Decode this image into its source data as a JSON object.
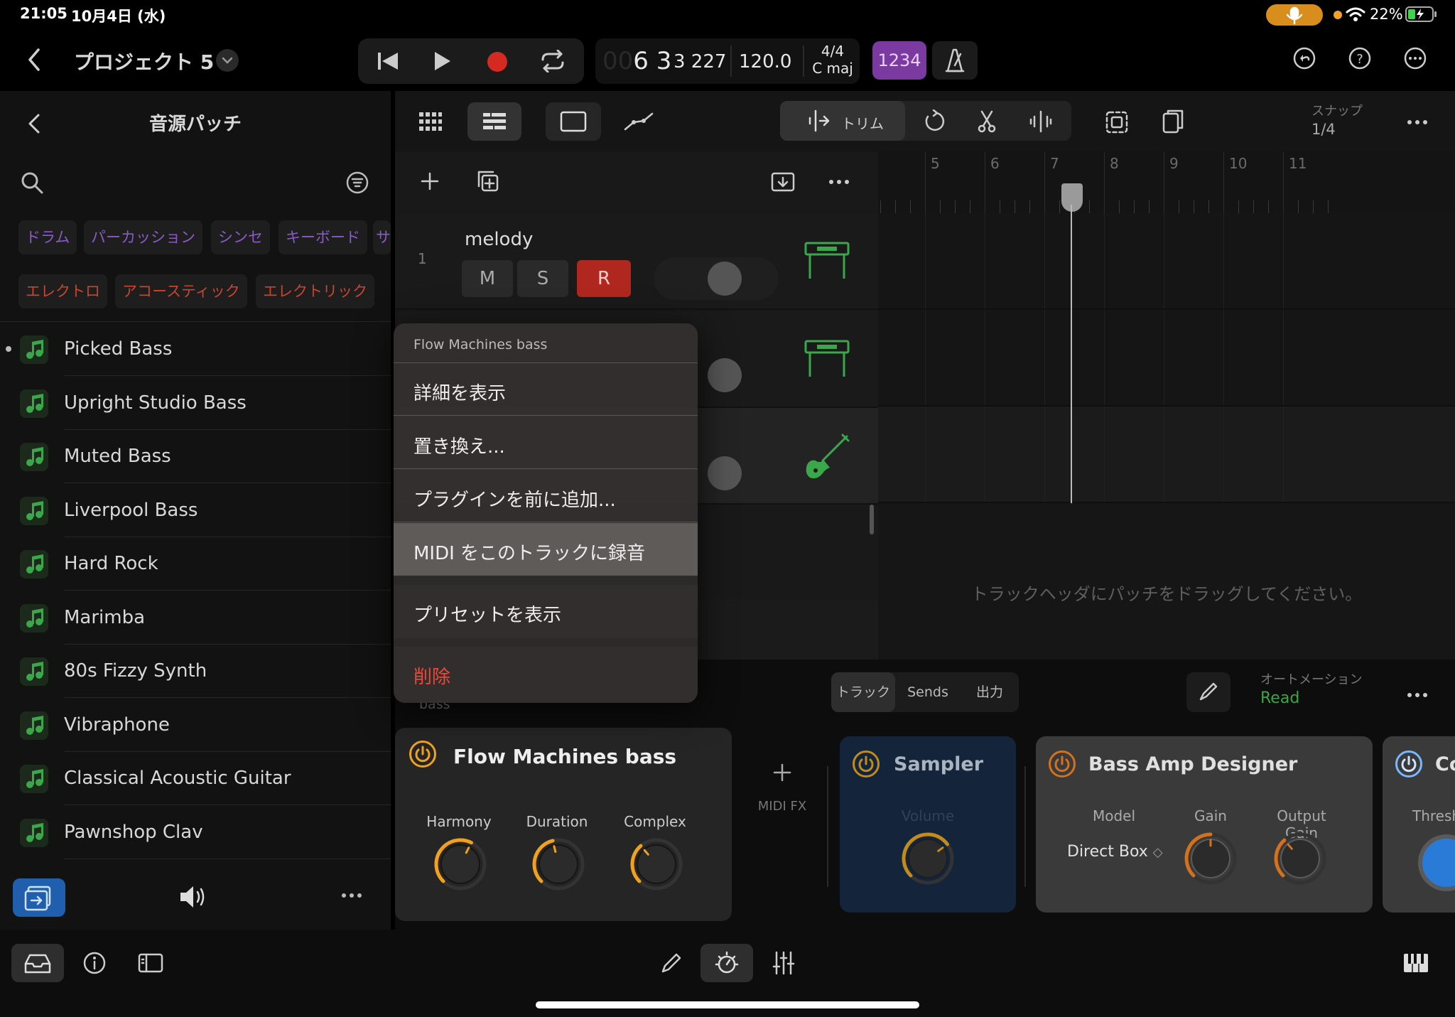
{
  "status_bar": {
    "time": "21:05",
    "date": "10月4日 (水)",
    "battery_pct": "22%",
    "mic_color": "#d98d1c"
  },
  "top_bar": {
    "project_title": "プロジェクト 5",
    "lcd": {
      "bar_dim": "00",
      "bar": "6",
      "beat": "3",
      "division_tick": "3 227",
      "tempo": "120.0",
      "time_signature": "4/4",
      "key": "C maj"
    },
    "count_in": "1234"
  },
  "browser": {
    "title": "音源パッチ",
    "category_chips": [
      "ドラム",
      "パーカッション",
      "シンセ",
      "キーボード",
      "サ"
    ],
    "style_chips": [
      "エレクトロ",
      "アコースティック",
      "エレクトリック"
    ],
    "patches": [
      "Picked Bass",
      "Upright Studio Bass",
      "Muted Bass",
      "Liverpool Bass",
      "Hard Rock",
      "Marimba",
      "80s Fizzy Synth",
      "Vibraphone",
      "Classical Acoustic Guitar",
      "Pawnshop Clav"
    ],
    "selected_index": 0
  },
  "tracks_toolbar": {
    "trim_label": "トリム",
    "snap_label": "スナップ",
    "snap_value": "1/4"
  },
  "ruler": {
    "bars": [
      "5",
      "6",
      "7",
      "8",
      "9",
      "10",
      "11"
    ]
  },
  "tracks": [
    {
      "number": "1",
      "name": "melody",
      "mute": "M",
      "solo": "S",
      "record": "R",
      "icon": "keyboard-icon"
    },
    {
      "number": "",
      "name": "",
      "icon": "keyboard-icon"
    },
    {
      "number": "",
      "name": "",
      "icon": "bass-guitar-icon"
    }
  ],
  "drag_hint": "トラックヘッダにパッチをドラッグしてください。",
  "inspector": {
    "hidden_label": "bass",
    "tabs": [
      "トラック",
      "Sends",
      "出力"
    ],
    "selected_tab": 0,
    "automation_label": "オートメーション",
    "automation_value": "Read",
    "midi_fx_label": "MIDI FX",
    "plugins": [
      {
        "name": "Flow Machines bass",
        "params": [
          {
            "label": "Harmony",
            "value": 0.6
          },
          {
            "label": "Duration",
            "value": 0.45
          },
          {
            "label": "Complex",
            "value": 0.35
          }
        ]
      },
      {
        "name": "Sampler",
        "params": [
          {
            "label": "Volume",
            "value": 0.7
          }
        ]
      },
      {
        "name": "Bass Amp Designer",
        "model_label": "Model",
        "model_value": "Direct Box",
        "params": [
          {
            "label": "Gain",
            "value": 0.5
          },
          {
            "label": "Output Gain",
            "value": 0.35
          }
        ]
      },
      {
        "name": "Co",
        "params": [
          {
            "label": "Thresh",
            "value": 0.8
          }
        ]
      }
    ]
  },
  "context_menu": {
    "header": "Flow Machines bass",
    "items": [
      "詳細を表示",
      "置き換え...",
      "プラグインを前に追加...",
      "MIDI をこのトラックに録音",
      "プリセットを表示"
    ],
    "highlighted_index": 3,
    "delete_label": "削除"
  },
  "colors": {
    "accent_green": "#3fa34a",
    "record_red": "#b0271f",
    "count_in_purple": "#7a3aa0",
    "plugin_orange": "#f0a21e",
    "delete_red": "#e8493b"
  }
}
